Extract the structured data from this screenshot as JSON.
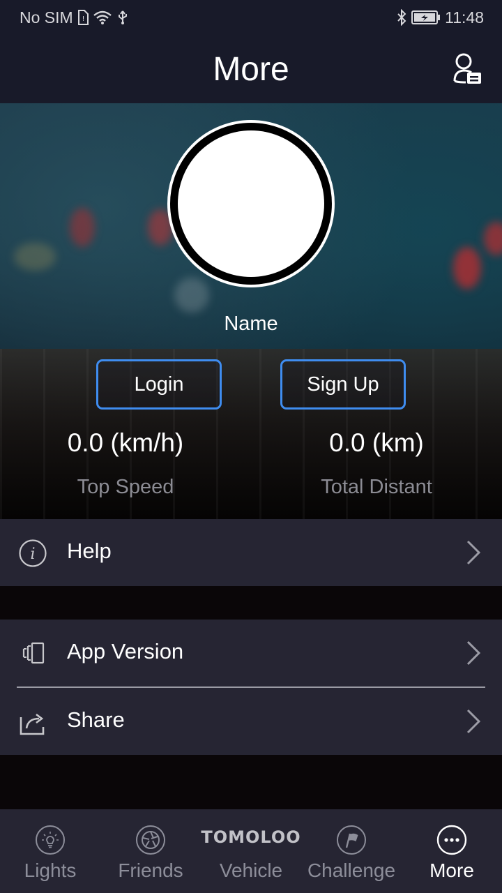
{
  "status_bar": {
    "carrier": "No SIM",
    "time": "11:48"
  },
  "header": {
    "title": "More"
  },
  "profile": {
    "name": "Name",
    "login_label": "Login",
    "signup_label": "Sign Up",
    "stats": [
      {
        "value": "0.0 (km/h)",
        "label": "Top Speed"
      },
      {
        "value": "0.0 (km)",
        "label": "Total Distant"
      }
    ]
  },
  "menu": {
    "help": "Help",
    "app_version": "App Version",
    "share": "Share"
  },
  "tabs": [
    {
      "label": "Lights",
      "icon": "bulb-icon"
    },
    {
      "label": "Friends",
      "icon": "aperture-icon"
    },
    {
      "label": "Vehicle",
      "icon": "tomoloo-logo",
      "logo_text": "TOMOLOO"
    },
    {
      "label": "Challenge",
      "icon": "flag-icon"
    },
    {
      "label": "More",
      "icon": "more-dots-icon"
    }
  ],
  "colors": {
    "bar_background": "#181a29",
    "menu_background": "#262533",
    "accent_button_border": "#3f8df0",
    "inactive_tab_text": "#8d8e9a",
    "active_tab_text": "#ffffff"
  }
}
